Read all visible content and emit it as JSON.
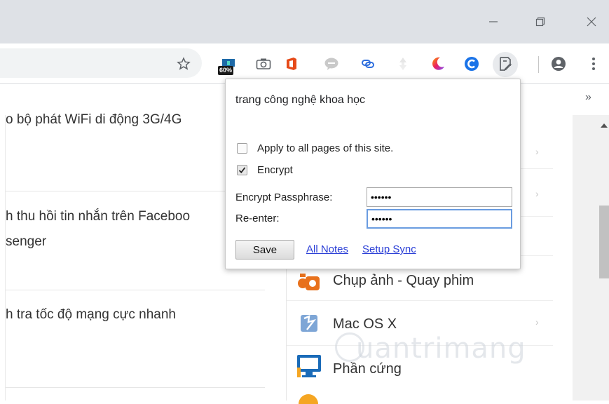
{
  "window": {
    "controls": [
      "minimize",
      "restore",
      "close"
    ]
  },
  "toolbar": {
    "extension_badge": "60%",
    "icons": [
      "star-icon",
      "display-ext-icon",
      "camera-icon",
      "office-icon",
      "chat-bubble-icon",
      "link-ext-icon",
      "arrow-ext-icon",
      "moon-icon",
      "c-ext-icon",
      "notes-ext-icon",
      "account-icon",
      "menu-icon"
    ],
    "more": "»"
  },
  "article": {
    "lines": [
      "o bộ phát WiFi di động 3G/4G",
      "h thu hồi tin nhắn trên Faceboo",
      "senger",
      "h tra tốc độ mạng cực nhanh"
    ]
  },
  "categories": [
    {
      "label": "Chụp ảnh - Quay phim",
      "icon": "camera-category-icon",
      "color": "#e8711c"
    },
    {
      "label": "Mac OS X",
      "icon": "mac-os-icon",
      "color": "#4a7fc1"
    },
    {
      "label": "Phần cứng",
      "icon": "hardware-icon",
      "color": "#1a6bb8"
    }
  ],
  "watermark": "uantrimang",
  "popup": {
    "title": "trang công nghệ khoa học",
    "apply_all_label": "Apply to all pages of this site.",
    "apply_all_checked": false,
    "encrypt_label": "Encrypt",
    "encrypt_checked": true,
    "passphrase_label": "Encrypt Passphrase:",
    "passphrase_value": "••••••",
    "reenter_label": "Re-enter:",
    "reenter_value": "••••••",
    "save_label": "Save",
    "all_notes_label": "All Notes",
    "setup_sync_label": "Setup Sync"
  }
}
